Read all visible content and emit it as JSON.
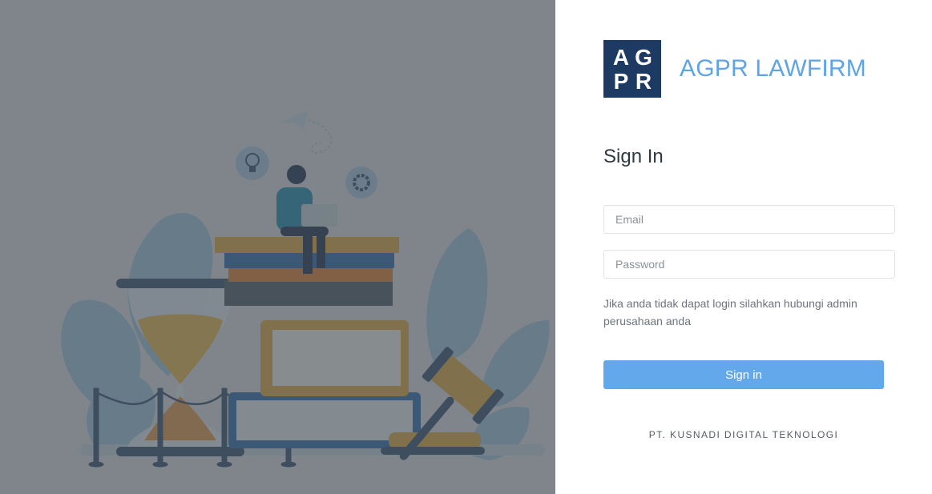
{
  "brand": {
    "logo_letters": [
      "A",
      "G",
      "P",
      "R"
    ],
    "name": "AGPR LAWFIRM",
    "logo_color": "#1d3a63",
    "name_color": "#5fa4e6"
  },
  "signin": {
    "title": "Sign In",
    "email_placeholder": "Email",
    "email_value": "",
    "password_placeholder": "Password",
    "password_value": "",
    "help_text": "Jika anda tidak dapat login silahkan hubungi admin perusahaan anda",
    "button_label": "Sign in",
    "button_color": "#64a8ec"
  },
  "footer": {
    "company": "PT. KUSNADI DIGITAL TEKNOLOGI"
  },
  "illustration": {
    "subject": "person-on-books-with-hourglass-and-gavel-illustration",
    "icons": [
      "paper-plane-icon",
      "lightbulb-icon",
      "gear-icon"
    ]
  }
}
